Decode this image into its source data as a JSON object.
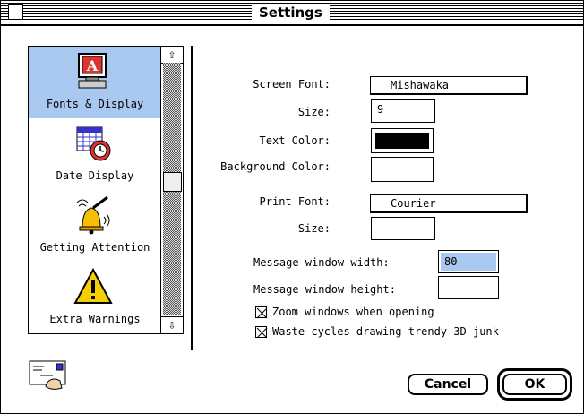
{
  "window": {
    "title": "Settings"
  },
  "sidebar": {
    "items": [
      {
        "label": "Fonts & Display",
        "icon": "fonts-display-icon",
        "selected": true
      },
      {
        "label": "Date Display",
        "icon": "date-display-icon",
        "selected": false
      },
      {
        "label": "Getting Attention",
        "icon": "bell-icon",
        "selected": false
      },
      {
        "label": "Extra Warnings",
        "icon": "warning-icon",
        "selected": false
      }
    ]
  },
  "form": {
    "screen_font_label": "Screen Font:",
    "screen_font_value": "Mishawaka",
    "size_label": "Size:",
    "size_value": "9",
    "text_color_label": "Text Color:",
    "text_color_value": "#000000",
    "background_color_label": "Background Color:",
    "background_color_value": "#ffffff",
    "print_font_label": "Print Font:",
    "print_font_value": "Courier",
    "print_size_label": "Size:",
    "print_size_value": "",
    "message_width_label": "Message window width:",
    "message_width_value": "80",
    "message_height_label": "Message window height:",
    "message_height_value": "",
    "zoom_label": "Zoom windows when opening",
    "zoom_checked": true,
    "waste_label": "Waste cycles drawing trendy 3D junk",
    "waste_checked": true
  },
  "buttons": {
    "cancel": "Cancel",
    "ok": "OK"
  },
  "colors": {
    "selection": "#a8c8f0",
    "text_highlight": "#a8c8f0"
  }
}
